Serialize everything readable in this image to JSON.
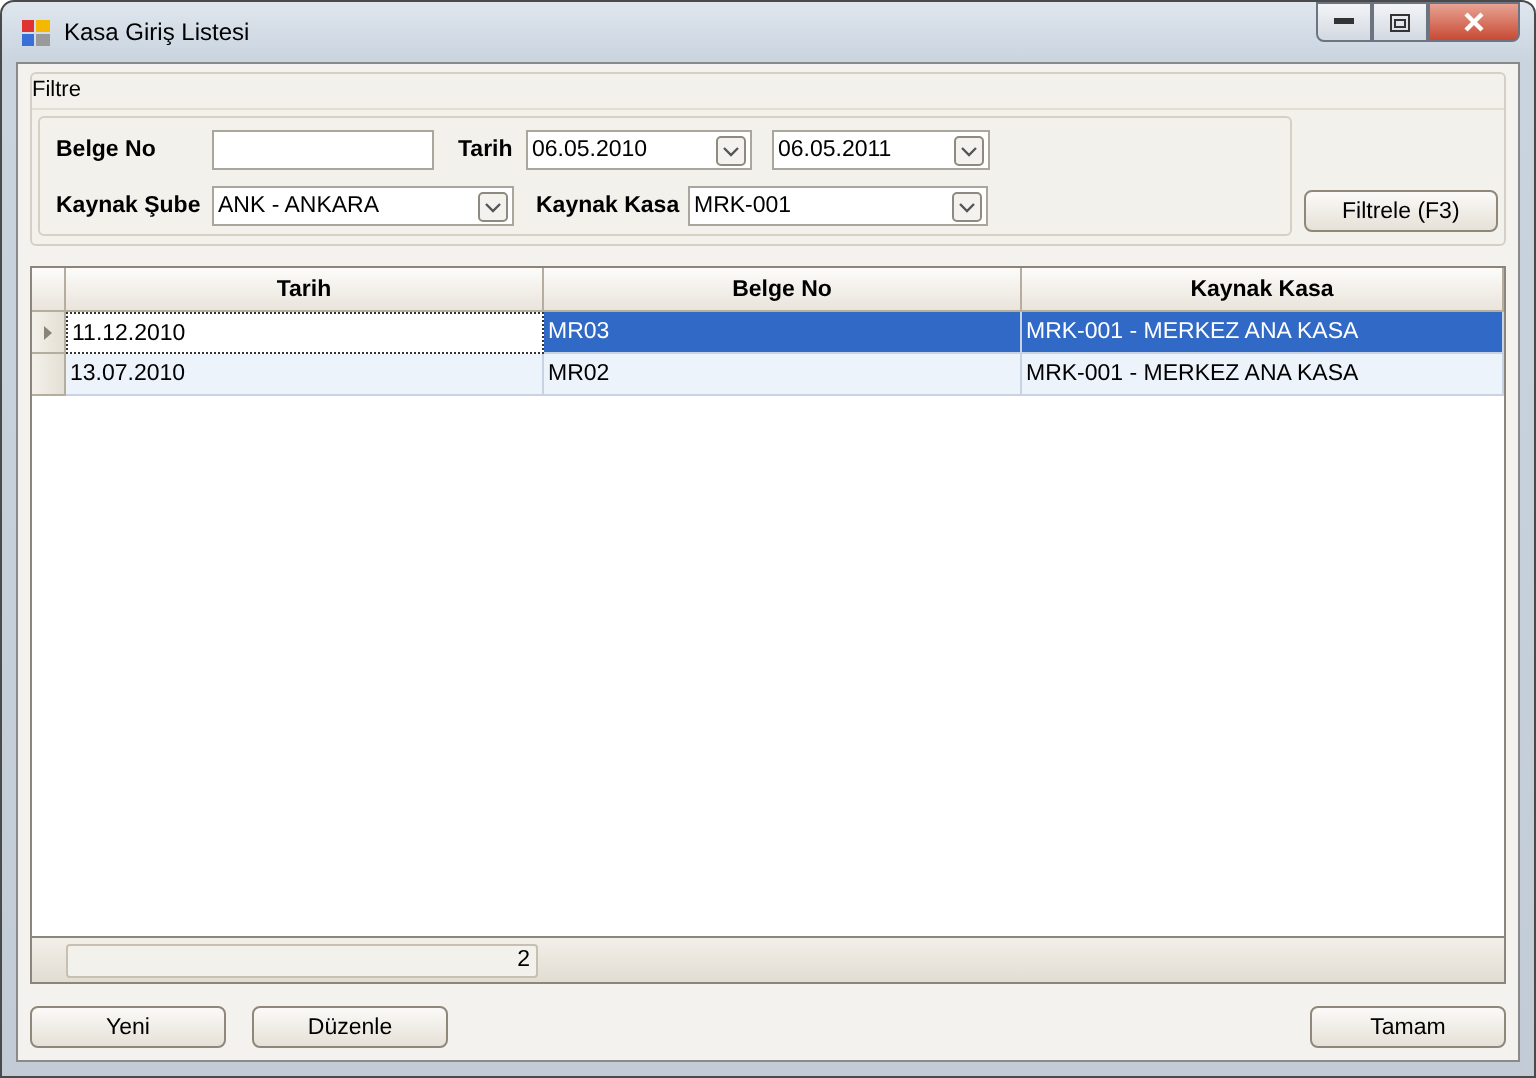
{
  "window": {
    "title": "Kasa Giriş Listesi"
  },
  "filter": {
    "title": "Filtre",
    "belge_no": {
      "label": "Belge No"
    },
    "tarih": {
      "label": "Tarih",
      "from": "06.05.2010",
      "to": "06.05.2011"
    },
    "kaynak_sube": {
      "label": "Kaynak Şube",
      "value": "ANK - ANKARA"
    },
    "kaynak_kasa": {
      "label": "Kaynak Kasa",
      "value": "MRK-001"
    },
    "button": "Filtrele (F3)"
  },
  "table": {
    "columns": [
      "Tarih",
      "Belge No",
      "Kaynak Kasa"
    ],
    "rows": [
      {
        "cells": [
          "11.12.2010",
          "MR03",
          "MRK-001 - MERKEZ ANA KASA"
        ],
        "selected": true
      },
      {
        "cells": [
          "13.07.2010",
          "MR02",
          "MRK-001 - MERKEZ ANA KASA"
        ],
        "selected": false
      }
    ],
    "footer": {
      "count": "2"
    }
  },
  "buttons": {
    "left": [
      "Yeni",
      "Düzenle"
    ],
    "right": [
      "Tamam"
    ]
  }
}
